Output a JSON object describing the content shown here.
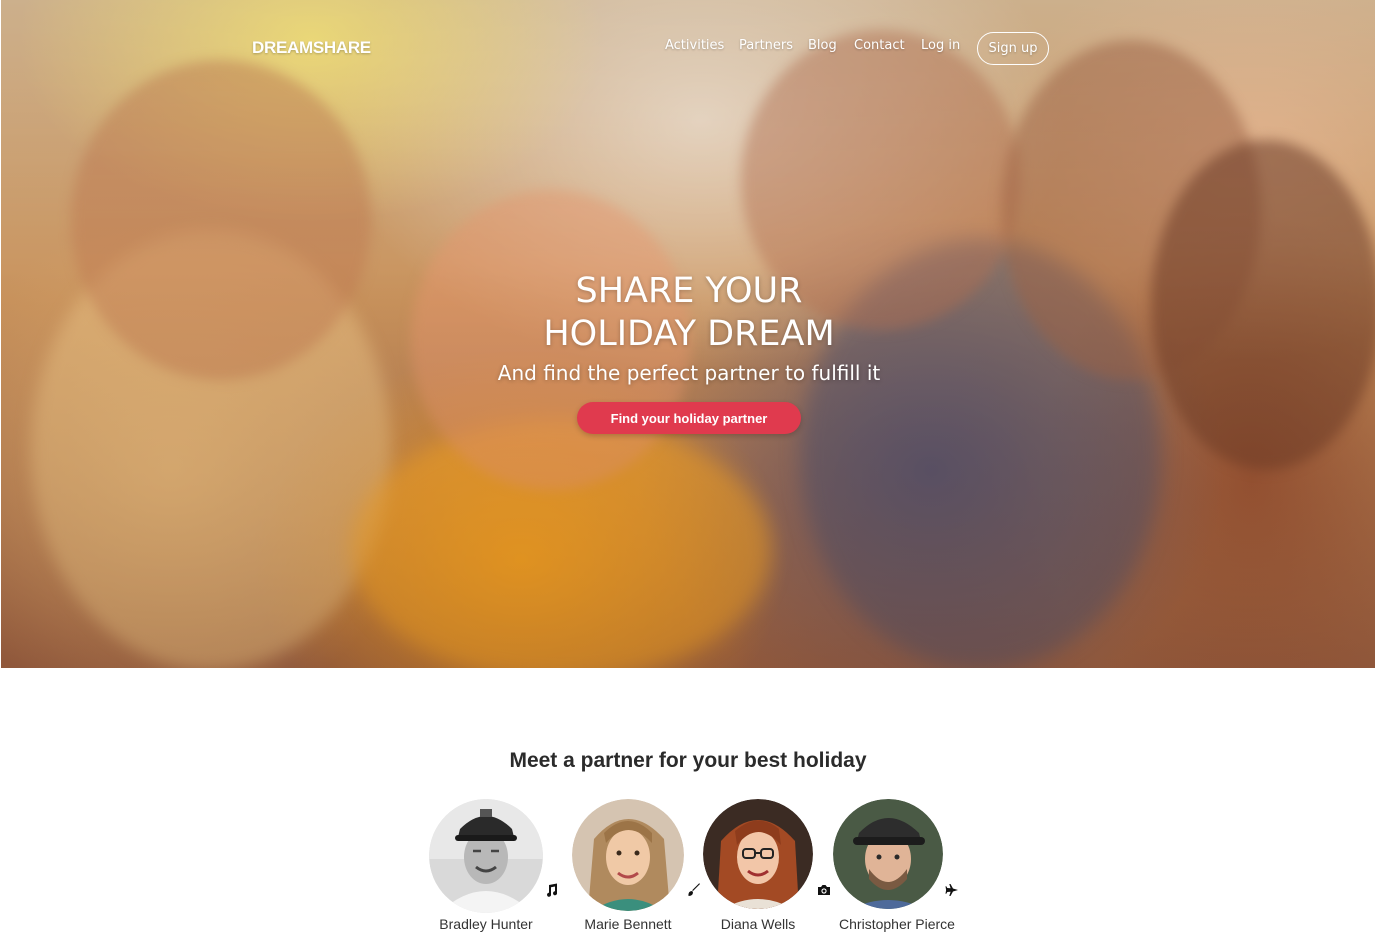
{
  "brand": {
    "logo": "DREAMSHARE"
  },
  "nav": {
    "links": [
      "Activities",
      "Partners",
      "Blog",
      "Contact",
      "Log in"
    ],
    "signup": "Sign up"
  },
  "hero": {
    "title_line1": "SHARE YOUR",
    "title_line2": "HOLIDAY DREAM",
    "subtitle": "And find the perfect partner to fulfill it",
    "cta": "Find your holiday partner"
  },
  "partners_section": {
    "title": "Meet a partner for your best holiday",
    "partners": [
      {
        "name": "Bradley Hunter",
        "icon": "music-note-icon"
      },
      {
        "name": "Marie Bennett",
        "icon": "paintbrush-icon"
      },
      {
        "name": "Diana Wells",
        "icon": "camera-icon"
      },
      {
        "name": "Christopher Pierce",
        "icon": "airplane-icon"
      }
    ]
  },
  "colors": {
    "cta": "#e03a4e",
    "text_dark": "#2b2b2b"
  }
}
